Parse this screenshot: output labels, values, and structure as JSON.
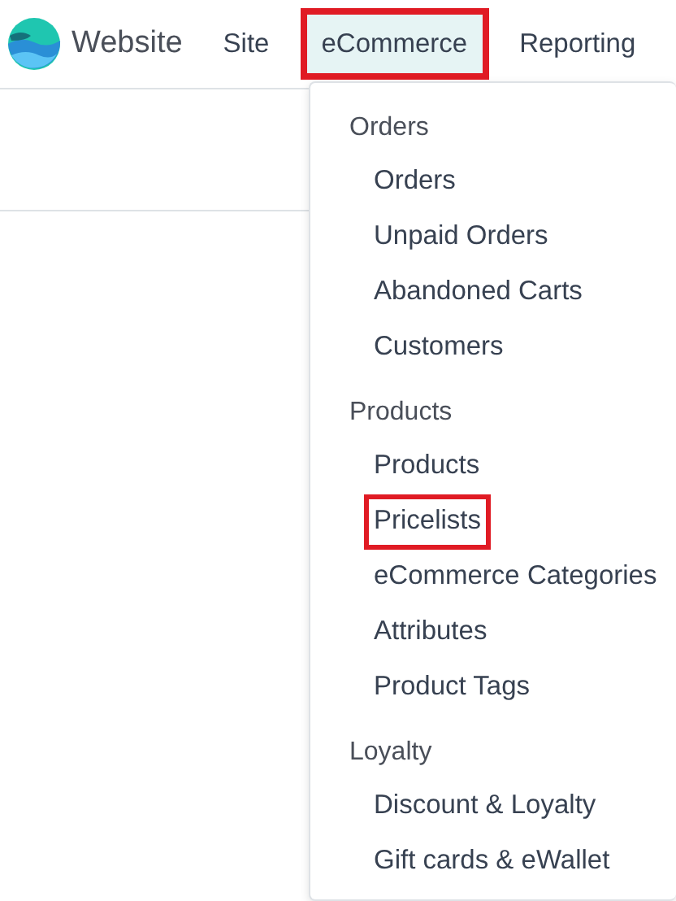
{
  "app": {
    "title": "Website"
  },
  "menu": [
    {
      "label": "Site",
      "selected": false,
      "highlighted": false
    },
    {
      "label": "eCommerce",
      "selected": true,
      "highlighted": true
    },
    {
      "label": "Reporting",
      "selected": false,
      "highlighted": false
    }
  ],
  "dropdown": [
    {
      "heading": "Orders",
      "items": [
        {
          "label": "Orders",
          "highlighted": false
        },
        {
          "label": "Unpaid Orders",
          "highlighted": false
        },
        {
          "label": "Abandoned Carts",
          "highlighted": false
        },
        {
          "label": "Customers",
          "highlighted": false
        }
      ]
    },
    {
      "heading": "Products",
      "items": [
        {
          "label": "Products",
          "highlighted": false
        },
        {
          "label": "Pricelists",
          "highlighted": true
        },
        {
          "label": "eCommerce Categories",
          "highlighted": false
        },
        {
          "label": "Attributes",
          "highlighted": false
        },
        {
          "label": "Product Tags",
          "highlighted": false
        }
      ]
    },
    {
      "heading": "Loyalty",
      "items": [
        {
          "label": "Discount & Loyalty",
          "highlighted": false
        },
        {
          "label": "Gift cards & eWallet",
          "highlighted": false
        }
      ]
    }
  ]
}
